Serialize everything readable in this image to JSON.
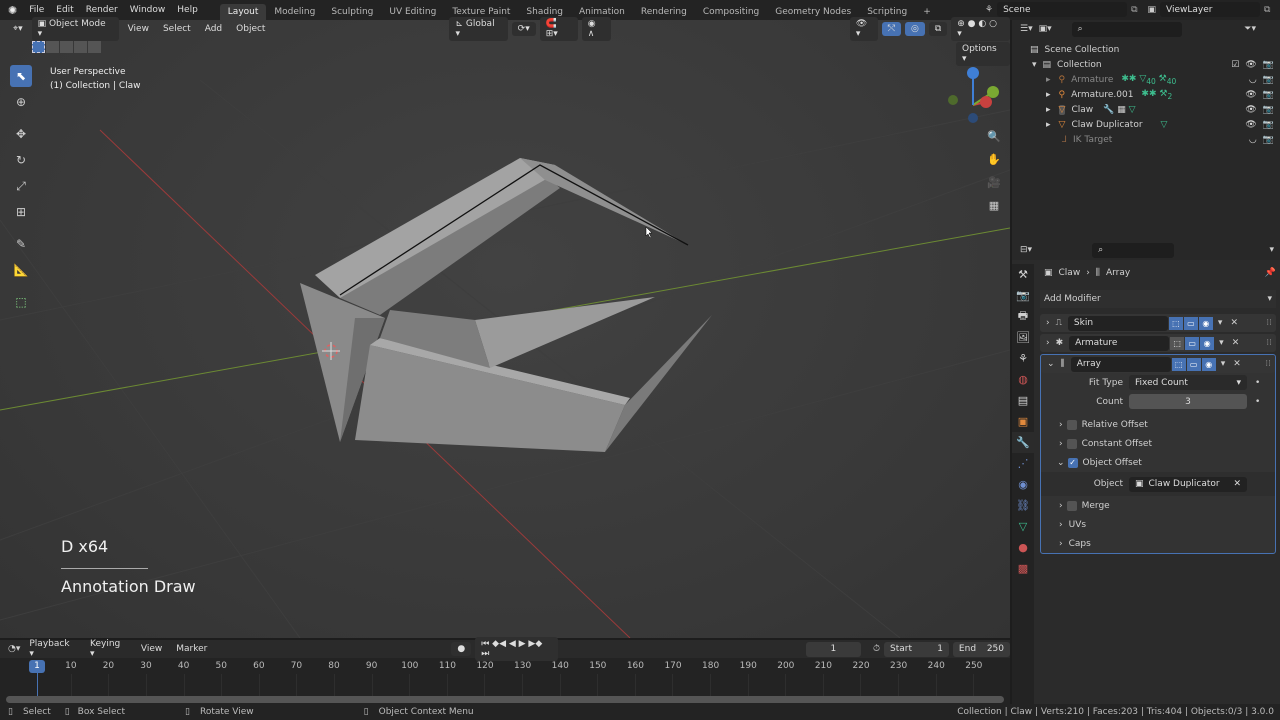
{
  "topbar": {
    "menus": [
      "File",
      "Edit",
      "Render",
      "Window",
      "Help"
    ],
    "workspaces": [
      "Layout",
      "Modeling",
      "Sculpting",
      "UV Editing",
      "Texture Paint",
      "Shading",
      "Animation",
      "Rendering",
      "Compositing",
      "Geometry Nodes",
      "Scripting"
    ],
    "active_workspace": "Layout",
    "add_workspace": "+",
    "scene": "Scene",
    "view_layer": "ViewLayer"
  },
  "viewport": {
    "mode": "Object Mode",
    "menus": [
      "View",
      "Select",
      "Add",
      "Object"
    ],
    "transform_orientation": "Global",
    "options": "Options",
    "overlay_title": "User Perspective",
    "overlay_subtitle": "(1) Collection | Claw",
    "operator_info": "D x64",
    "operator_name": "Annotation Draw",
    "gizmo_axes": [
      "X",
      "Y",
      "Z"
    ]
  },
  "outliner": {
    "search_placeholder": "",
    "scene_collection": "Scene Collection",
    "collection": "Collection",
    "items": [
      {
        "name": "Armature",
        "disabled": true,
        "badges": [
          "40",
          "40"
        ]
      },
      {
        "name": "Armature.001",
        "disabled": false,
        "badges": [
          "2"
        ]
      },
      {
        "name": "Claw",
        "disabled": false,
        "badges": []
      },
      {
        "name": "Claw Duplicator",
        "disabled": false,
        "badges": []
      },
      {
        "name": "IK Target",
        "disabled": true,
        "badges": []
      }
    ]
  },
  "properties": {
    "breadcrumb": [
      "Claw",
      "Array"
    ],
    "add_modifier": "Add Modifier",
    "modifiers": [
      {
        "name": "Skin",
        "expanded": false
      },
      {
        "name": "Armature",
        "expanded": false
      },
      {
        "name": "Array",
        "expanded": true
      }
    ],
    "array": {
      "fit_type_label": "Fit Type",
      "fit_type": "Fixed Count",
      "count_label": "Count",
      "count": "3",
      "relative_offset": "Relative Offset",
      "relative_checked": false,
      "constant_offset": "Constant Offset",
      "constant_checked": false,
      "object_offset": "Object Offset",
      "object_checked": true,
      "object_label": "Object",
      "object_value": "Claw Duplicator",
      "merge": "Merge",
      "merge_checked": false,
      "uvs": "UVs",
      "caps": "Caps"
    }
  },
  "timeline": {
    "menus": [
      "Playback",
      "Keying",
      "View",
      "Marker"
    ],
    "current_frame": "1",
    "start_label": "Start",
    "start": "1",
    "end_label": "End",
    "end": "250",
    "ticks": [
      "10",
      "20",
      "30",
      "40",
      "50",
      "60",
      "70",
      "80",
      "90",
      "100",
      "110",
      "120",
      "130",
      "140",
      "150",
      "160",
      "170",
      "180",
      "190",
      "200",
      "210",
      "220",
      "230",
      "240",
      "250"
    ]
  },
  "status": {
    "select": "Select",
    "box_select": "Box Select",
    "rotate_view": "Rotate View",
    "context_menu": "Object Context Menu",
    "stats": "Collection | Claw | Verts:210 | Faces:203 | Tris:404 | Objects:0/3 | 3.0.0"
  },
  "colors": {
    "accent": "#4772b3",
    "x_axis": "#c8413f",
    "y_axis": "#7aa832",
    "z_axis": "#3f7fd6",
    "object_orange": "#e28a3c",
    "data_green": "#3dbd8e"
  }
}
